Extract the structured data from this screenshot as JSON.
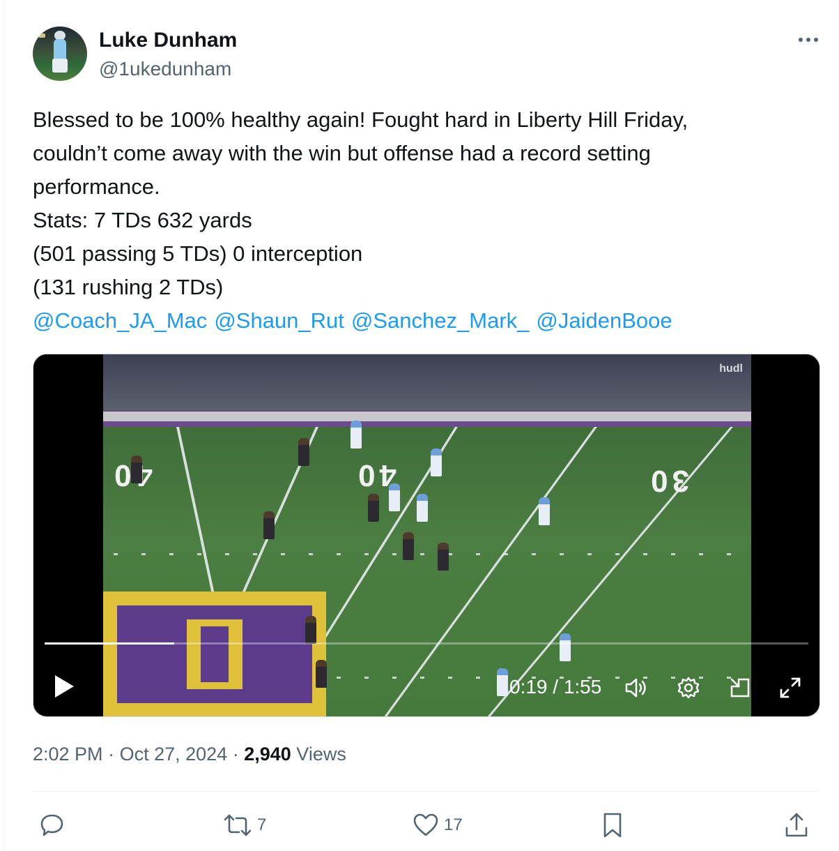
{
  "author": {
    "display_name": "Luke Dunham",
    "handle": "@1ukedunham"
  },
  "tweet": {
    "lines": [
      "Blessed to be 100% healthy again! Fought hard in Liberty Hill Friday,",
      "couldn’t come away with the win but offense had a record setting",
      "performance.",
      "Stats: 7 TDs 632 yards",
      "(501 passing 5 TDs) 0 interception",
      "(131 rushing 2 TDs)"
    ],
    "mentions": [
      "@Coach_JA_Mac",
      "@Shaun_Rut",
      "@Sanchez_Mark_",
      "@JaidenBooe"
    ]
  },
  "video": {
    "watermark": "hudl",
    "time_display": "0:19 / 1:55",
    "progress": 0.17,
    "field_numbers": [
      "40",
      "30",
      "40"
    ]
  },
  "meta": {
    "time": "2:02 PM",
    "date": "Oct 27, 2024",
    "views_count": "2,940",
    "views_label": "Views"
  },
  "actions": {
    "reply_count": "",
    "retweet_count": "7",
    "like_count": "17"
  },
  "icons": {
    "more": "more-dots-icon",
    "reply": "reply-bubble-icon",
    "retweet": "retweet-icon",
    "like": "heart-icon",
    "bookmark": "bookmark-icon",
    "share": "share-icon",
    "play": "play-icon",
    "volume": "volume-icon",
    "settings": "gear-icon",
    "pip": "picture-in-picture-icon",
    "fullscreen": "expand-icon"
  },
  "colors": {
    "link": "#1d9bf0",
    "secondary_text": "#536471",
    "primary_text": "#0f1419"
  }
}
